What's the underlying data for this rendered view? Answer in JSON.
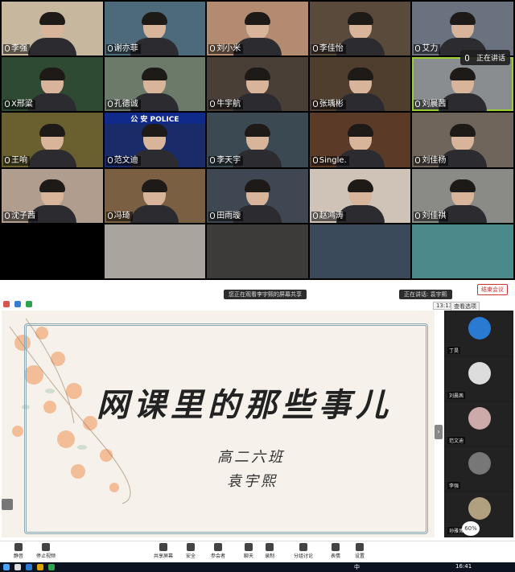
{
  "gallery": {
    "tiles": [
      {
        "name": "李强",
        "muted": true,
        "bg": "#c7b79e"
      },
      {
        "name": "谢亦菲",
        "muted": true,
        "bg": "#4d6a7a"
      },
      {
        "name": "刘小米",
        "muted": true,
        "bg": "#b28b70"
      },
      {
        "name": "李佳怡",
        "muted": true,
        "bg": "#5a4a3c"
      },
      {
        "name": "艾力",
        "muted": true,
        "bg": "#6a7280"
      },
      {
        "name": "X邢粱",
        "muted": true,
        "bg": "#2e4a32"
      },
      {
        "name": "孔德诚",
        "muted": true,
        "bg": "#6c7a6a"
      },
      {
        "name": "牛宇航",
        "muted": true,
        "bg": "#4a3f36"
      },
      {
        "name": "张瑀彬",
        "muted": true,
        "bg": "#4f3d2e"
      },
      {
        "name": "刘晨茜",
        "muted": true,
        "bg": "#8a8d90"
      },
      {
        "name": "王响",
        "muted": true,
        "bg": "#6a5f2e"
      },
      {
        "name": "范文迪",
        "muted": true,
        "bg": "#1a2b6a",
        "police": true
      },
      {
        "name": "李天宇",
        "muted": true,
        "bg": "#3b4a52"
      },
      {
        "name": "Single.",
        "muted": true,
        "bg": "#5b3a28"
      },
      {
        "name": "刘佳杨",
        "muted": true,
        "bg": "#70655b"
      },
      {
        "name": "沈子茜",
        "muted": true,
        "bg": "#b09d8e"
      },
      {
        "name": "冯琦",
        "muted": true,
        "bg": "#7a5f42"
      },
      {
        "name": "田雨璇",
        "muted": true,
        "bg": "#3f4852"
      },
      {
        "name": "赵鸿涛",
        "muted": true,
        "bg": "#cfc3b7"
      },
      {
        "name": "刘佳祺",
        "muted": true,
        "bg": "#8a8a86"
      },
      {
        "name": "",
        "muted": false,
        "bg": "#000000"
      },
      {
        "name": "",
        "muted": false,
        "bg": "#a9a59e"
      },
      {
        "name": "",
        "muted": false,
        "bg": "#3c3b3a"
      },
      {
        "name": "",
        "muted": false,
        "bg": "#3a4a5a"
      },
      {
        "name": "",
        "muted": false,
        "bg": "#4a8a8a"
      }
    ],
    "speaking_label": "正在讲话"
  },
  "share": {
    "banner": "您正在观看李宇熙的屏幕共享",
    "talk_banner": "正在讲话: 袁宇熙",
    "time": "13:13",
    "view_label": "查看选项"
  },
  "slide": {
    "title": "网课里的那些事儿",
    "class": "高二六班",
    "author": "袁宇熙"
  },
  "strip": {
    "names": [
      "丁昊",
      "刘晨茜",
      "范文迪",
      "李强",
      "孙雅博"
    ],
    "badge": "60%"
  },
  "toolbar": {
    "items": [
      "静音",
      "停止视频",
      "共享屏幕",
      "安全",
      "参会者",
      "聊天",
      "录制",
      "分组讨论",
      "表情",
      "设置"
    ],
    "end_label": "结束会议"
  },
  "taskbar": {
    "lang": "中",
    "time": "16:41"
  }
}
